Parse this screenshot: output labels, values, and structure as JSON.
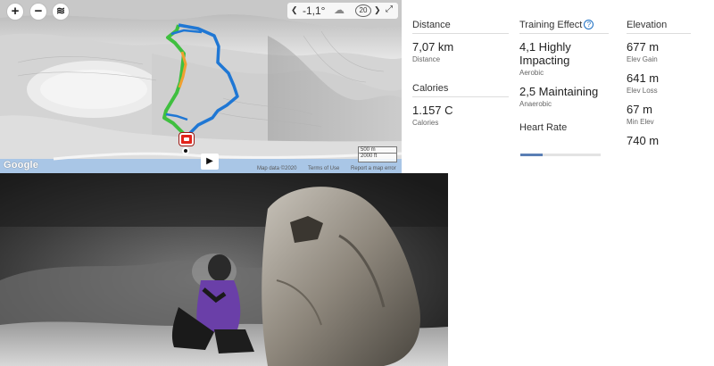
{
  "map": {
    "zoom_in_label": "+",
    "zoom_out_label": "−",
    "weather": {
      "temperature": "-1,1°",
      "wind": "20"
    },
    "attribution": "Google",
    "map_data": "Map data ©2020",
    "terms": "Terms of Use",
    "report": "Report a map error",
    "scale_metric": "500 m",
    "scale_imperial": "2000 ft",
    "colors": {
      "route_blue": "#1f77d4",
      "route_green": "#3fbf3f",
      "route_orange": "#f0a030",
      "marker_red": "#e2231a",
      "water": "#a9c6e6"
    }
  },
  "stats": {
    "distance": {
      "header": "Distance",
      "value": "7,07 km",
      "label": "Distance"
    },
    "calories": {
      "header": "Calories",
      "value": "1.157 C",
      "label": "Calories"
    },
    "training": {
      "header": "Training Effect",
      "aerobic_value": "4,1 Highly Impacting",
      "aerobic_label": "Aerobic",
      "anaerobic_value": "2,5 Maintaining",
      "anaerobic_label": "Anaerobic"
    },
    "heart_rate": {
      "header": "Heart Rate",
      "fill_fraction": 0.28
    },
    "elevation": {
      "header": "Elevation",
      "gain_value": "677 m",
      "gain_label": "Elev Gain",
      "loss_value": "641 m",
      "loss_label": "Elev Loss",
      "min_value": "67 m",
      "min_label": "Min Elev",
      "max_value": "740 m"
    }
  },
  "photo": {
    "subject": "hiker with headlamp beside large rock at night in fog"
  }
}
